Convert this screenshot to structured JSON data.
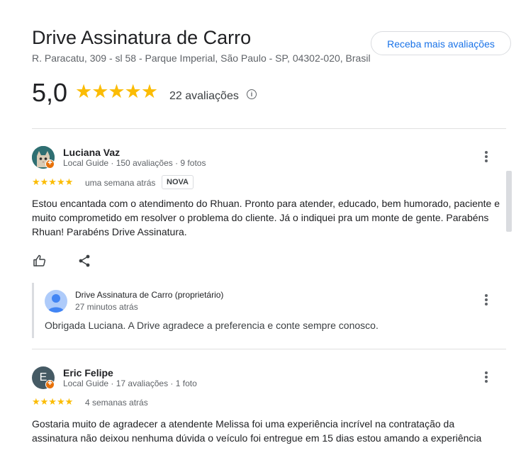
{
  "business": {
    "name": "Drive Assinatura de Carro",
    "address": "R. Paracatu, 309 - sl 58 - Parque Imperial, São Paulo - SP, 04302-020, Brasil",
    "more_reviews_button": "Receba mais avaliações",
    "rating": "5,0",
    "stars": "★★★★★",
    "reviews_count": "22 avaliações",
    "info_icon": "i"
  },
  "reviews": [
    {
      "author": "Luciana Vaz",
      "meta": "Local Guide · 150 avaliações · 9 fotos",
      "stars": "★★★★★",
      "when": "uma semana atrás",
      "badge": "NOVA",
      "text": "Estou encantada com o atendimento do Rhuan. Pronto para atender, educado, bem humorado, paciente e muito comprometido em resolver o problema do cliente. Já o indiquei pra um monte de gente. Parabéns Rhuan! Parabéns Drive Assinatura.",
      "owner_reply": {
        "name": "Drive Assinatura de Carro (proprietário)",
        "when": "27 minutos atrás",
        "text": "Obrigada Luciana. A Drive agradece a preferencia e conte sempre conosco."
      }
    },
    {
      "author": "Eric Felipe",
      "avatar_letter": "E",
      "meta": "Local Guide · 17 avaliações · 1 foto",
      "stars": "★★★★★",
      "when": "4 semanas atrás",
      "text": "Gostaria muito de agradecer a atendente Melissa foi uma experiência incrível na contratação da assinatura não deixou nenhuma dúvida o veículo foi entregue em 15 dias estou amando a experiência"
    }
  ],
  "colors": {
    "star": "#fbbc04",
    "link": "#1a73e8",
    "local_guide_badge": "#e8710a"
  },
  "icons": [
    "info-icon",
    "thumbs-up-icon",
    "share-icon",
    "more-vert-icon",
    "person-icon",
    "local-guide-badge-icon"
  ]
}
